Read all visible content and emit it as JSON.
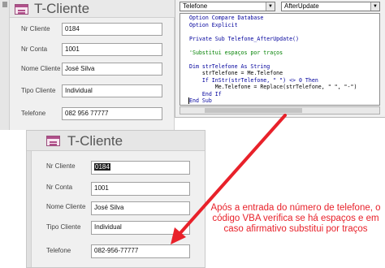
{
  "form_top": {
    "title": "T-Cliente",
    "fields": [
      {
        "label": "Nr Cliente",
        "value": "0184"
      },
      {
        "label": "Nr Conta",
        "value": "1001"
      },
      {
        "label": "Nome Cliente",
        "value": "José Silva"
      },
      {
        "label": "Tipo Cliente",
        "value": "Individual"
      },
      {
        "label": "Telefone",
        "value": "082 956 77777"
      }
    ]
  },
  "vba_editor": {
    "object_combo": "Telefone",
    "procedure_combo": "AfterUpdate",
    "code_lines": [
      "Option Compare Database",
      "Option Explicit",
      "",
      "Private Sub Telefone_AfterUpdate()",
      "",
      "'Substitui espaços por traços",
      "",
      "Dim strTelefone As String",
      "    strTelefone = Me.Telefone",
      "    If InStr(strTelefone, \" \") <> 0 Then",
      "        Me.Telefone = Replace(strTelefone, \" \", \"-\")",
      "    End If",
      "End Sub"
    ]
  },
  "form_bottom": {
    "title": "T-Cliente",
    "fields": [
      {
        "label": "Nr Cliente",
        "value": "0184"
      },
      {
        "label": "Nr Conta",
        "value": "1001"
      },
      {
        "label": "Nome Cliente",
        "value": "José Silva"
      },
      {
        "label": "Tipo Cliente",
        "value": "Individual"
      },
      {
        "label": "Telefone",
        "value": "082-956-77777"
      }
    ]
  },
  "annotation": {
    "text": "Após a entrada do número de telefone, o código VBA verifica se há espaços e em caso afirmativo substitui por traços"
  },
  "colors": {
    "annotation": "#e8212a",
    "arrow": "#e8212a",
    "code_keyword": "#00009c",
    "code_comment": "#008000"
  }
}
